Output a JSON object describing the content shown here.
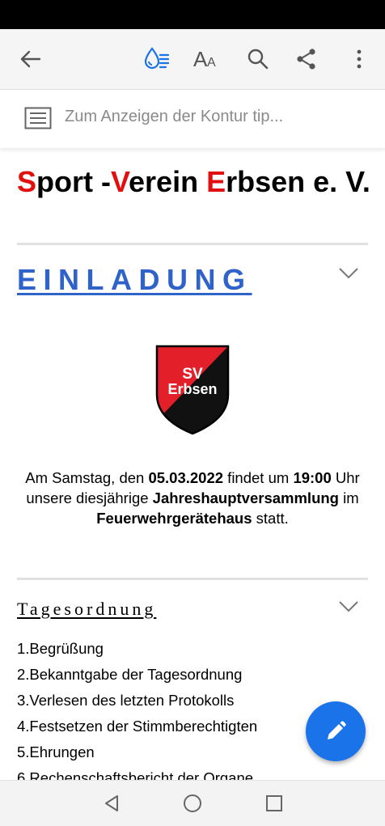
{
  "toolbar": {
    "icons": [
      "back-arrow-icon",
      "liquid-mode-icon",
      "text-size-icon",
      "search-icon",
      "share-icon",
      "more-vert-icon"
    ]
  },
  "outline_bar": {
    "placeholder": "Zum Anzeigen der Kontur tip..."
  },
  "document": {
    "title": {
      "s": "S",
      "port": "port -",
      "v": "V",
      "erein": "erein ",
      "e": "E",
      "rbsen": "rbsen e. V."
    },
    "section1": {
      "heading": "EINLADUNG"
    },
    "crest": {
      "line1": "SV",
      "line2": "Erbsen",
      "colors": {
        "red": "#e3202a",
        "black": "#111111"
      }
    },
    "invitation": {
      "p1": "Am Samstag, den ",
      "date": "05.03.2022",
      "p2": " findet um ",
      "time": "19:00",
      "p3": " Uhr",
      "p4": "unsere diesjährige ",
      "event": "Jahreshauptversammlung",
      "p5": " im",
      "place": "Feuerwehrgerätehaus",
      "p6": " statt."
    },
    "section2": {
      "heading": "Tagesordnung"
    },
    "agenda": [
      "1.Begrüßung",
      "2.Bekanntgabe der Tagesordnung",
      "3.Verlesen des letzten Protokolls",
      "4.Festsetzen der Stimmberechtigten",
      "5.Ehrungen",
      "6.Rechenschaftsbericht der Organe"
    ]
  },
  "fab": {
    "icon": "pencil-edit-icon",
    "color": "#1a73e8"
  },
  "nav": {
    "icons": [
      "back-triangle-icon",
      "home-circle-icon",
      "recents-square-icon"
    ]
  },
  "colors": {
    "accent_blue": "#2f63c9",
    "title_red": "#e20f0f"
  }
}
